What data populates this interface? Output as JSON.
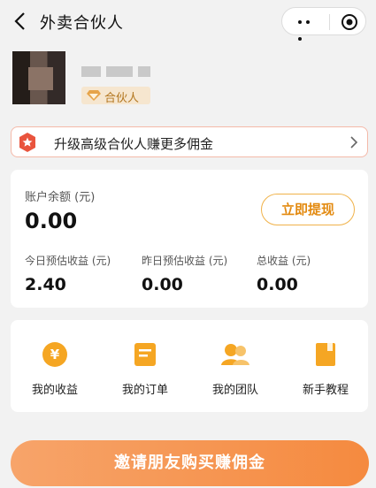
{
  "nav": {
    "title": "外卖合伙人"
  },
  "profile": {
    "badge": "合伙人"
  },
  "upgrade": {
    "text": "升级高级合伙人赚更多佣金"
  },
  "balance": {
    "label": "账户余额 (元)",
    "value": "0.00",
    "withdraw_label": "立即提现"
  },
  "stats": [
    {
      "label": "今日预估收益 (元)",
      "value": "2.40"
    },
    {
      "label": "昨日预估收益 (元)",
      "value": "0.00"
    },
    {
      "label": "总收益 (元)",
      "value": "0.00"
    }
  ],
  "functions": [
    {
      "label": "我的收益",
      "icon": "yen-coin-icon"
    },
    {
      "label": "我的订单",
      "icon": "order-list-icon"
    },
    {
      "label": "我的团队",
      "icon": "team-icon"
    },
    {
      "label": "新手教程",
      "icon": "tutorial-book-icon"
    }
  ],
  "cta": {
    "label": "邀请朋友购买赚佣金"
  },
  "colors": {
    "accent": "#f5a623",
    "cta": "#f58a3f",
    "badge_text": "#b2761f"
  }
}
